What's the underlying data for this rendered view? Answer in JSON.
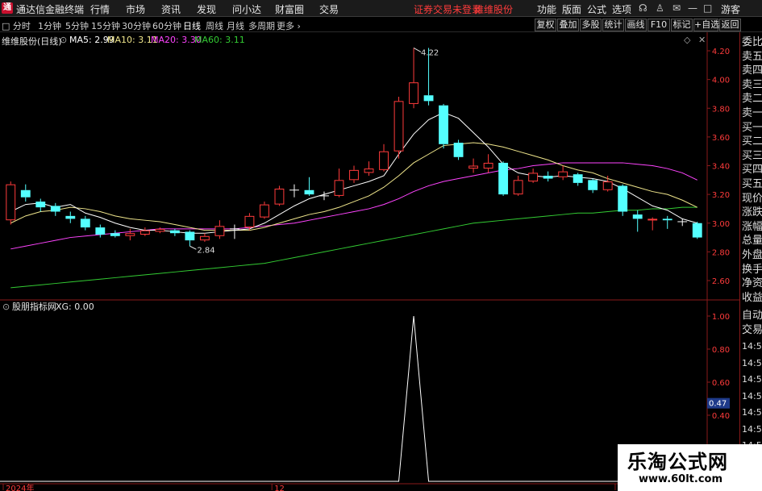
{
  "app": {
    "name": "通达信金融终端",
    "logo_char": "通",
    "menu": [
      "行情",
      "市场",
      "资讯",
      "发现",
      "问小达",
      "财富圈",
      "交易"
    ],
    "notice": "证券交易未登录",
    "stock_name": "维维股份",
    "right_menu": [
      "功能",
      "版面",
      "公式",
      "选项"
    ],
    "user": "游客",
    "window_icons": [
      "headset-icon",
      "shirt-icon",
      "message-icon",
      "minimize-icon",
      "maximize-icon",
      "close-icon"
    ]
  },
  "periods": [
    "分时",
    "1分钟",
    "5分钟",
    "15分钟",
    "30分钟",
    "60分钟",
    "日线",
    "周线",
    "月线",
    "多周期",
    "更多"
  ],
  "active_period": "日线",
  "toolbar_buttons": [
    "复权",
    "叠加",
    "多股",
    "统计",
    "画线",
    "F10",
    "标记",
    "+自选",
    "返回"
  ],
  "main_info": {
    "title": "维维股份(日线)",
    "ma5": "MA5: 2.99",
    "ma10": "MA10: 3.11",
    "ma20": "MA20: 3.30",
    "ma60": "MA60: 3.11"
  },
  "sub_info": {
    "title": "股朋指标网",
    "xg": "XG: 0.00"
  },
  "colors": {
    "up": "#ff3b3b",
    "down": "#54ffff",
    "ma5": "#ffffff",
    "ma10": "#f0e68c",
    "ma20": "#ff44ff",
    "ma60": "#33cc33",
    "axis": "#8a1a1a"
  },
  "right_panel": {
    "labels": [
      "委比",
      "卖五",
      "卖四",
      "卖三",
      "卖二",
      "卖一",
      "买一",
      "买二",
      "买三",
      "买四",
      "买五",
      "现价",
      "涨跌",
      "涨幅",
      "总量",
      "外盘",
      "换手",
      "净资",
      "收益"
    ],
    "bottom_labels": [
      "自动",
      "交易"
    ],
    "times": [
      "14:56",
      "14:56",
      "14:56",
      "14:56",
      "14:56",
      "14:56",
      "14:56",
      "14:56",
      "14:56"
    ]
  },
  "chart_data": {
    "type": "candlestick",
    "ylim": [
      2.5,
      4.3
    ],
    "price_ticks": [
      "4.20",
      "4.00",
      "3.80",
      "3.60",
      "3.40",
      "3.20",
      "3.00",
      "2.80",
      "2.60"
    ],
    "price_tick_values": [
      4.2,
      4.0,
      3.8,
      3.6,
      3.4,
      3.2,
      3.0,
      2.8,
      2.6
    ],
    "candles": [
      {
        "o": 3.02,
        "c": 3.27,
        "h": 3.29,
        "l": 2.99
      },
      {
        "o": 3.23,
        "c": 3.18,
        "h": 3.27,
        "l": 3.15
      },
      {
        "o": 3.15,
        "c": 3.11,
        "h": 3.17,
        "l": 3.08
      },
      {
        "o": 3.12,
        "c": 3.08,
        "h": 3.14,
        "l": 3.05
      },
      {
        "o": 3.05,
        "c": 3.03,
        "h": 3.08,
        "l": 3.0
      },
      {
        "o": 3.03,
        "c": 2.97,
        "h": 3.05,
        "l": 2.95
      },
      {
        "o": 2.97,
        "c": 2.92,
        "h": 2.99,
        "l": 2.9
      },
      {
        "o": 2.93,
        "c": 2.91,
        "h": 2.95,
        "l": 2.9
      },
      {
        "o": 2.91,
        "c": 2.93,
        "h": 2.96,
        "l": 2.88
      },
      {
        "o": 2.92,
        "c": 2.95,
        "h": 2.97,
        "l": 2.91
      },
      {
        "o": 2.94,
        "c": 2.96,
        "h": 2.97,
        "l": 2.93
      },
      {
        "o": 2.95,
        "c": 2.93,
        "h": 2.96,
        "l": 2.91
      },
      {
        "o": 2.94,
        "c": 2.88,
        "h": 2.95,
        "l": 2.84
      },
      {
        "o": 2.88,
        "c": 2.91,
        "h": 2.93,
        "l": 2.87
      },
      {
        "o": 2.91,
        "c": 2.98,
        "h": 3.02,
        "l": 2.89
      },
      {
        "o": 2.96,
        "c": 2.96,
        "h": 2.99,
        "l": 2.89
      },
      {
        "o": 2.97,
        "c": 3.05,
        "h": 3.07,
        "l": 2.95
      },
      {
        "o": 3.04,
        "c": 3.13,
        "h": 3.15,
        "l": 3.03
      },
      {
        "o": 3.13,
        "c": 3.24,
        "h": 3.26,
        "l": 3.12
      },
      {
        "o": 3.23,
        "c": 3.23,
        "h": 3.27,
        "l": 3.18
      },
      {
        "o": 3.23,
        "c": 3.2,
        "h": 3.32,
        "l": 3.19
      },
      {
        "o": 3.19,
        "c": 3.19,
        "h": 3.22,
        "l": 3.16
      },
      {
        "o": 3.19,
        "c": 3.3,
        "h": 3.38,
        "l": 3.18
      },
      {
        "o": 3.3,
        "c": 3.37,
        "h": 3.4,
        "l": 3.28
      },
      {
        "o": 3.35,
        "c": 3.38,
        "h": 3.43,
        "l": 3.33
      },
      {
        "o": 3.37,
        "c": 3.5,
        "h": 3.55,
        "l": 3.36
      },
      {
        "o": 3.5,
        "c": 3.85,
        "h": 3.88,
        "l": 3.45
      },
      {
        "o": 3.83,
        "c": 3.98,
        "h": 4.22,
        "l": 3.8
      },
      {
        "o": 3.89,
        "c": 3.85,
        "h": 4.22,
        "l": 3.82
      },
      {
        "o": 3.82,
        "c": 3.55,
        "h": 3.83,
        "l": 3.52
      },
      {
        "o": 3.56,
        "c": 3.46,
        "h": 3.58,
        "l": 3.44
      },
      {
        "o": 3.38,
        "c": 3.4,
        "h": 3.45,
        "l": 3.35
      },
      {
        "o": 3.38,
        "c": 3.42,
        "h": 3.48,
        "l": 3.35
      },
      {
        "o": 3.42,
        "c": 3.2,
        "h": 3.43,
        "l": 3.19
      },
      {
        "o": 3.2,
        "c": 3.3,
        "h": 3.33,
        "l": 3.19
      },
      {
        "o": 3.29,
        "c": 3.35,
        "h": 3.38,
        "l": 3.28
      },
      {
        "o": 3.33,
        "c": 3.31,
        "h": 3.36,
        "l": 3.29
      },
      {
        "o": 3.32,
        "c": 3.36,
        "h": 3.4,
        "l": 3.3
      },
      {
        "o": 3.34,
        "c": 3.28,
        "h": 3.35,
        "l": 3.26
      },
      {
        "o": 3.3,
        "c": 3.23,
        "h": 3.31,
        "l": 3.21
      },
      {
        "o": 3.23,
        "c": 3.29,
        "h": 3.33,
        "l": 3.22
      },
      {
        "o": 3.26,
        "c": 3.08,
        "h": 3.27,
        "l": 3.05
      },
      {
        "o": 3.06,
        "c": 3.03,
        "h": 3.09,
        "l": 2.94
      },
      {
        "o": 3.02,
        "c": 3.03,
        "h": 3.04,
        "l": 2.95
      },
      {
        "o": 3.03,
        "c": 3.02,
        "h": 3.05,
        "l": 2.96
      },
      {
        "o": 3.01,
        "c": 3.01,
        "h": 3.03,
        "l": 2.98
      },
      {
        "o": 3.0,
        "c": 2.9,
        "h": 3.01,
        "l": 2.89
      }
    ],
    "ma5": [
      3.08,
      3.13,
      3.14,
      3.11,
      3.13,
      3.07,
      3.04,
      3.0,
      2.97,
      2.95,
      2.95,
      2.94,
      2.93,
      2.93,
      2.94,
      2.95,
      2.96,
      3.0,
      3.06,
      3.12,
      3.17,
      3.2,
      3.23,
      3.26,
      3.29,
      3.33,
      3.48,
      3.62,
      3.72,
      3.77,
      3.73,
      3.63,
      3.53,
      3.41,
      3.35,
      3.33,
      3.32,
      3.33,
      3.32,
      3.31,
      3.29,
      3.24,
      3.18,
      3.12,
      3.09,
      3.03,
      3.0
    ],
    "ma10": [
      3.0,
      3.05,
      3.08,
      3.09,
      3.11,
      3.1,
      3.08,
      3.05,
      3.03,
      3.02,
      3.01,
      2.99,
      2.97,
      2.95,
      2.95,
      2.95,
      2.95,
      2.97,
      3.0,
      3.03,
      3.06,
      3.08,
      3.11,
      3.15,
      3.19,
      3.25,
      3.33,
      3.42,
      3.48,
      3.54,
      3.55,
      3.56,
      3.55,
      3.53,
      3.5,
      3.47,
      3.44,
      3.4,
      3.37,
      3.35,
      3.31,
      3.28,
      3.25,
      3.22,
      3.2,
      3.16,
      3.11
    ],
    "ma20": [
      2.82,
      2.84,
      2.86,
      2.88,
      2.9,
      2.91,
      2.92,
      2.93,
      2.94,
      2.95,
      2.96,
      2.96,
      2.96,
      2.96,
      2.96,
      2.96,
      2.97,
      2.98,
      2.99,
      3.0,
      3.02,
      3.04,
      3.06,
      3.08,
      3.1,
      3.13,
      3.17,
      3.22,
      3.26,
      3.29,
      3.31,
      3.33,
      3.35,
      3.37,
      3.38,
      3.4,
      3.41,
      3.42,
      3.42,
      3.42,
      3.42,
      3.42,
      3.41,
      3.4,
      3.38,
      3.35,
      3.3
    ],
    "ma60": [
      2.55,
      2.56,
      2.57,
      2.58,
      2.59,
      2.6,
      2.61,
      2.62,
      2.63,
      2.64,
      2.65,
      2.66,
      2.67,
      2.68,
      2.69,
      2.7,
      2.71,
      2.72,
      2.74,
      2.76,
      2.78,
      2.8,
      2.82,
      2.84,
      2.86,
      2.88,
      2.9,
      2.92,
      2.94,
      2.96,
      2.98,
      3.0,
      3.01,
      3.02,
      3.03,
      3.04,
      3.05,
      3.06,
      3.07,
      3.07,
      3.08,
      3.09,
      3.09,
      3.1,
      3.1,
      3.11,
      3.11
    ],
    "high_label": "4.22",
    "low_label": "2.84",
    "sub_ylim": [
      0,
      1
    ],
    "sub_ticks": [
      "1.00",
      "0.80",
      "0.60",
      "0.40",
      "0.20"
    ],
    "sub_tick_values": [
      1.0,
      0.8,
      0.6,
      0.4,
      0.2
    ],
    "sub_current": "0.47",
    "sub_current_value": 0.47,
    "xg": [
      0,
      0,
      0,
      0,
      0,
      0,
      0,
      0,
      0,
      0,
      0,
      0,
      0,
      0,
      0,
      0,
      0,
      0,
      0,
      0,
      0,
      0,
      0,
      0,
      0,
      0,
      0,
      1,
      0,
      0,
      0,
      0,
      0,
      0,
      0,
      0,
      0,
      0,
      0,
      0,
      0,
      0,
      0,
      0,
      0,
      0,
      0
    ],
    "x_labels": [
      {
        "label": "2024年",
        "index": 0
      },
      {
        "label": "12",
        "index": 18
      },
      {
        "label": "1",
        "index": 41
      }
    ]
  }
}
